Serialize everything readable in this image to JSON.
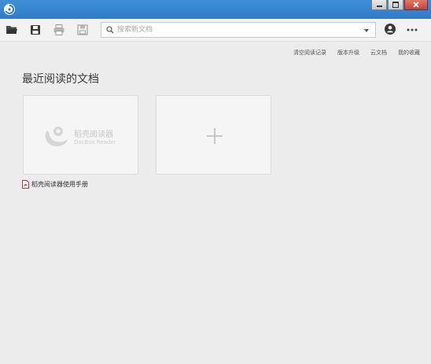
{
  "search": {
    "placeholder": "搜索新文档"
  },
  "header_links": [
    "清空阅读记录",
    "版本升级",
    "云文档",
    "我的收藏"
  ],
  "section": {
    "title": "最近阅读的文档"
  },
  "recent_docs": [
    {
      "file_name": "稻壳阅读器使用手册",
      "thumb_title": "稻壳阅读器",
      "thumb_subtitle": "DocBox Reader"
    }
  ],
  "icons": {
    "open": "folder-open-icon",
    "save": "save-icon",
    "print": "print-icon",
    "export": "floppy-icon",
    "search": "search-icon",
    "user": "user-icon",
    "more": "more-icon",
    "add": "plus-icon",
    "pdf": "pdf-icon"
  },
  "colors": {
    "titlebar": "#2f7cc8",
    "close": "#c7432f",
    "pdf": "#d0312d"
  }
}
